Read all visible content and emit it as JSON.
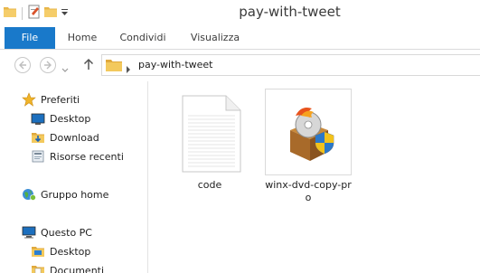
{
  "window": {
    "title": "pay-with-tweet"
  },
  "ribbon": {
    "tabs": [
      {
        "label": "File"
      },
      {
        "label": "Home"
      },
      {
        "label": "Condividi"
      },
      {
        "label": "Visualizza"
      }
    ]
  },
  "address_bar": {
    "path": "pay-with-tweet"
  },
  "nav_pane": {
    "favorites": {
      "label": "Preferiti",
      "items": [
        {
          "label": "Desktop"
        },
        {
          "label": "Download"
        },
        {
          "label": "Risorse recenti"
        }
      ]
    },
    "homegroup": {
      "label": "Gruppo home"
    },
    "this_pc": {
      "label": "Questo PC",
      "items": [
        {
          "label": "Desktop"
        },
        {
          "label": "Documenti"
        }
      ]
    }
  },
  "content": {
    "files": [
      {
        "name": "code",
        "icon": "text-file-icon"
      },
      {
        "name": "winx-dvd-copy-pro",
        "icon": "installer-box-icon"
      }
    ]
  },
  "colors": {
    "file_tab": "#1979ca",
    "folder": "#e8b64a",
    "selection": "#e5f3fb"
  }
}
